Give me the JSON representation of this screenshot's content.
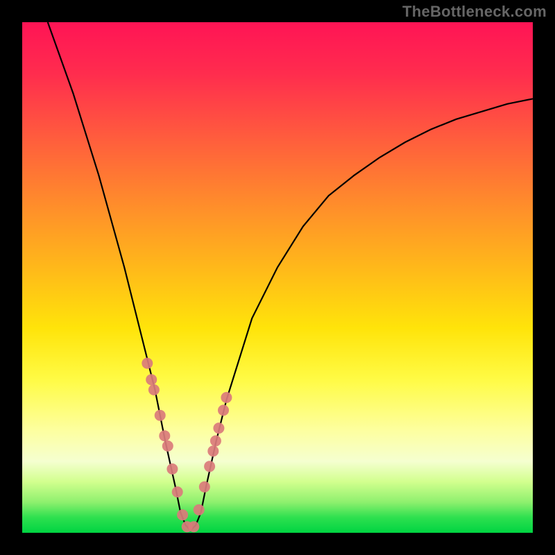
{
  "watermark": "TheBottleneck.com",
  "chart_data": {
    "type": "line",
    "title": "",
    "xlabel": "",
    "ylabel": "",
    "xlim": [
      0,
      100
    ],
    "ylim": [
      0,
      100
    ],
    "grid": false,
    "legend": false,
    "description": "V-shaped bottleneck curve: value drops to near 0 at the optimal point (~x=33) and rises toward 100 on either side. Background is a vertical gradient from red (top / high bottleneck) through yellow to green (bottom / low bottleneck).",
    "series": [
      {
        "name": "bottleneck-curve",
        "x": [
          5,
          10,
          15,
          20,
          23,
          26,
          28,
          30,
          31,
          32,
          33,
          34,
          35,
          36,
          38,
          40,
          45,
          50,
          55,
          60,
          65,
          70,
          75,
          80,
          85,
          90,
          95,
          100
        ],
        "y": [
          100,
          86,
          70,
          52,
          40,
          28,
          18,
          9,
          4,
          1.5,
          0.5,
          1.5,
          4,
          9,
          18,
          26,
          42,
          52,
          60,
          66,
          70,
          73.5,
          76.5,
          79,
          81,
          82.5,
          84,
          85
        ],
        "color": "#000000"
      },
      {
        "name": "highlight-dots",
        "x": [
          24.5,
          25.3,
          25.8,
          27.0,
          27.9,
          28.5,
          29.4,
          30.4,
          31.4,
          32.3,
          33.6,
          34.6,
          35.7,
          36.7,
          37.4,
          37.9,
          38.5,
          39.4,
          40.0
        ],
        "y": [
          33.2,
          30.0,
          28.0,
          23.0,
          19.0,
          17.0,
          12.5,
          8.0,
          3.5,
          1.2,
          1.2,
          4.5,
          9.0,
          13.0,
          16.0,
          18.0,
          20.5,
          24.0,
          26.5
        ],
        "color": "#da7b7b"
      }
    ],
    "gradient_stops": [
      {
        "pct": 0,
        "color": "#ff1455"
      },
      {
        "pct": 50,
        "color": "#ffd500"
      },
      {
        "pct": 85,
        "color": "#fdffa0"
      },
      {
        "pct": 100,
        "color": "#00d442"
      }
    ]
  }
}
